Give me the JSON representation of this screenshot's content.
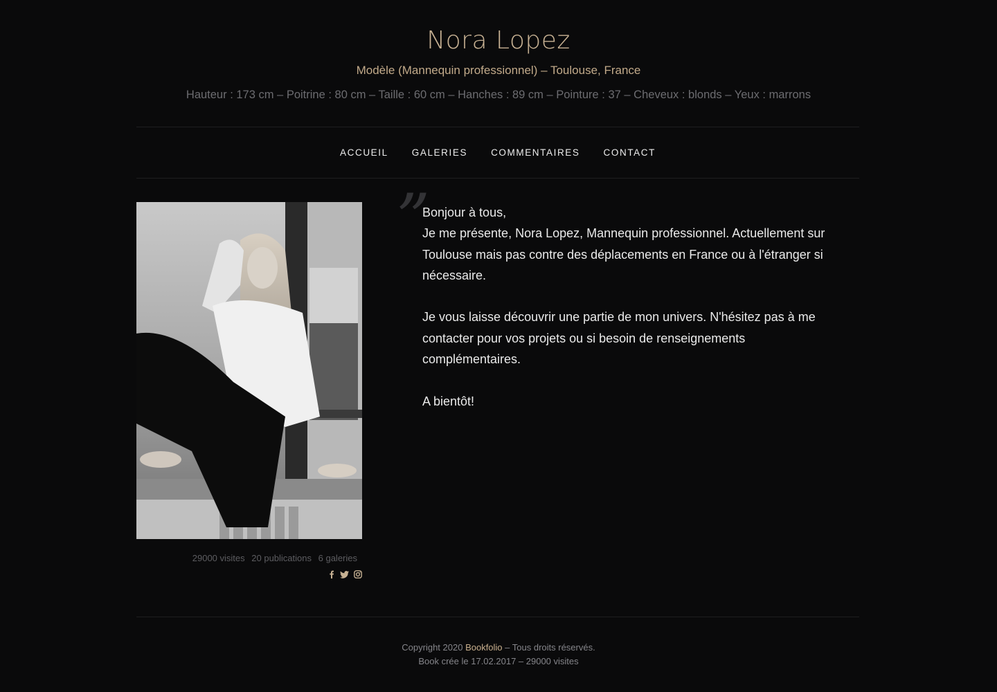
{
  "header": {
    "name": "Nora Lopez",
    "subtitle": "Modèle (Mannequin professionnel) – Toulouse, France",
    "specs": "Hauteur : 173 cm – Poitrine : 80 cm – Taille : 60 cm – Hanches : 89 cm – Pointure : 37 – Cheveux : blonds – Yeux : marrons"
  },
  "nav": {
    "items": [
      {
        "label": "ACCUEIL"
      },
      {
        "label": "GALERIES"
      },
      {
        "label": "COMMENTAIRES"
      },
      {
        "label": "CONTACT"
      }
    ]
  },
  "profile": {
    "stats": {
      "visits": "29000 visites",
      "publications": "20 publications",
      "galleries": "6 galeries"
    },
    "socials": [
      "facebook-icon",
      "twitter-icon",
      "instagram-icon"
    ]
  },
  "bio": {
    "quote_mark": "”",
    "paragraph1_line1": "Bonjour à tous,",
    "paragraph1_line2": "Je me présente, Nora Lopez, Mannequin professionnel. Actuellement sur Toulouse mais pas contre des déplacements en France ou à l'étranger si nécessaire.",
    "paragraph2": "Je vous laisse découvrir une partie de mon univers. N'hésitez pas à me contacter pour vos projets ou si besoin de renseignements complémentaires.",
    "paragraph3": "A bientôt!"
  },
  "footer": {
    "copyright_prefix": "Copyright 2020 ",
    "brand": "Bookfolio",
    "copyright_suffix": " – Tous droits réservés.",
    "line2": "Book crée le 17.02.2017 – 29000 visites"
  },
  "colors": {
    "background": "#0a0a0b",
    "accent": "#c7b193",
    "text": "#eaeaea",
    "muted": "#6c6c70"
  }
}
